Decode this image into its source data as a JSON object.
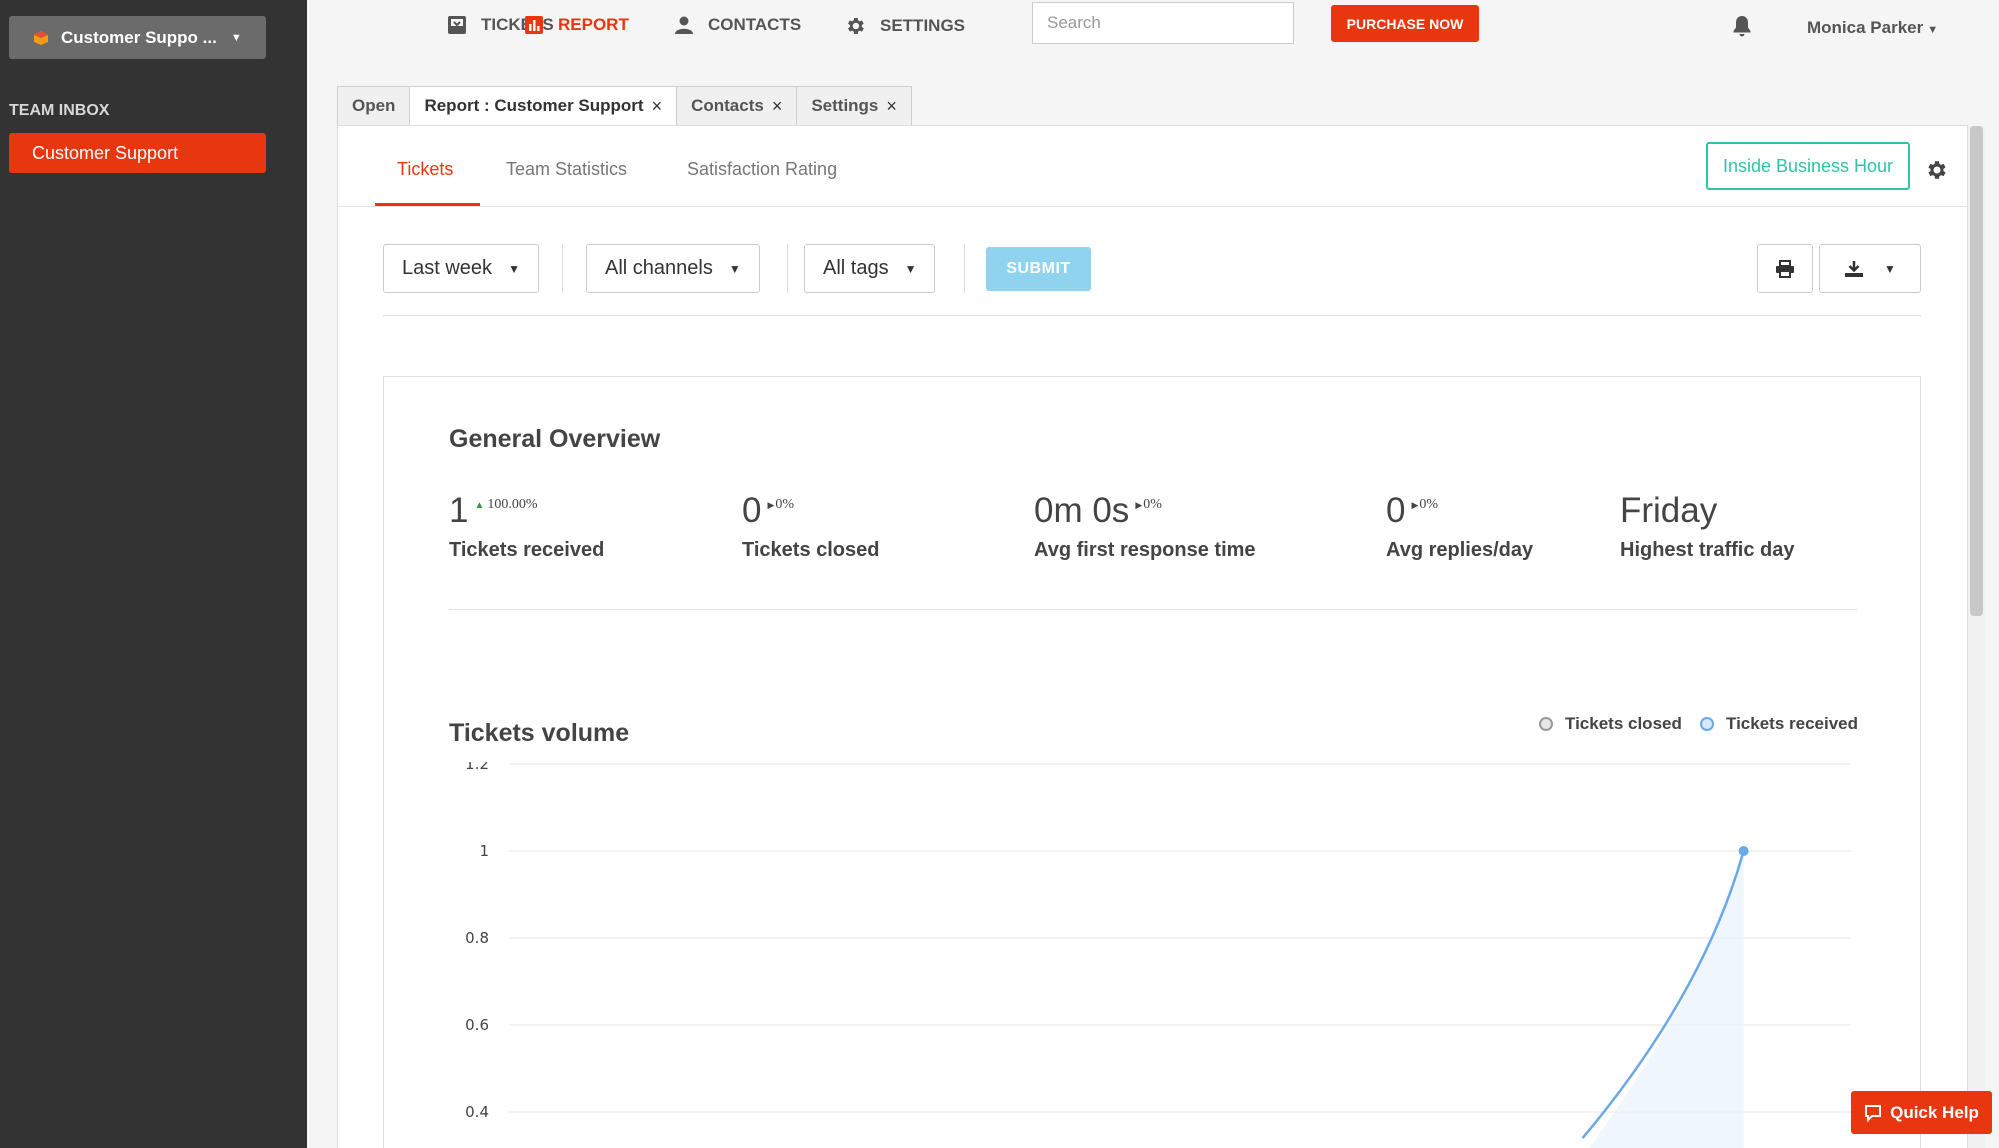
{
  "sidebar": {
    "inbox_selector": "Customer Suppo ...",
    "section_label": "TEAM INBOX",
    "items": [
      {
        "label": "Customer Support",
        "active": true
      }
    ]
  },
  "topnav": {
    "items": [
      {
        "label": "TICKETS",
        "icon": "ticket-icon"
      },
      {
        "label": "REPORT",
        "icon": "report-icon",
        "active": true
      },
      {
        "label": "CONTACTS",
        "icon": "contact-icon"
      },
      {
        "label": "SETTINGS",
        "icon": "gear-icon"
      }
    ],
    "search_placeholder": "Search",
    "purchase_label": "PURCHASE NOW",
    "user_name": "Monica Parker"
  },
  "tabs": [
    {
      "label": "Open",
      "closable": false
    },
    {
      "label": "Report : Customer Support",
      "closable": true,
      "active": true
    },
    {
      "label": "Contacts",
      "closable": true
    },
    {
      "label": "Settings",
      "closable": true
    }
  ],
  "close_glyph": "×",
  "subtabs": [
    "Tickets",
    "Team Statistics",
    "Satisfaction Rating"
  ],
  "business_hour_label": "Inside Business Hour",
  "filters": {
    "period": "Last week",
    "channels": "All channels",
    "tags": "All tags",
    "submit_label": "SUBMIT"
  },
  "overview": {
    "title": "General Overview",
    "stats": [
      {
        "value": "1",
        "delta": "100.00%",
        "trend": "up",
        "label": "Tickets received"
      },
      {
        "value": "0",
        "delta": "0%",
        "trend": "flat",
        "label": "Tickets closed"
      },
      {
        "value": "0m 0s",
        "delta": "0%",
        "trend": "flat",
        "label": "Avg first response time"
      },
      {
        "value": "0",
        "delta": "0%",
        "trend": "flat",
        "label": "Avg replies/day"
      },
      {
        "value": "Friday",
        "delta": "",
        "trend": "",
        "label": "Highest traffic day"
      }
    ]
  },
  "volume": {
    "title": "Tickets volume",
    "legend": [
      {
        "name": "Tickets closed",
        "color": "#999999"
      },
      {
        "name": "Tickets received",
        "color": "#6aa8e8"
      }
    ]
  },
  "chart_data": {
    "type": "line",
    "title": "Tickets volume",
    "y_ticks": [
      "1.2",
      "1",
      "0.8",
      "0.6",
      "0.4"
    ],
    "ylim": [
      0.4,
      1.2
    ],
    "grid": true,
    "legend_position": "top-right",
    "series": [
      {
        "name": "Tickets received",
        "color": "#6aa8e8",
        "points_visible": [
          {
            "x_frac": 0.8,
            "y": 0.34
          },
          {
            "x_frac": 0.92,
            "y": 1
          }
        ]
      },
      {
        "name": "Tickets closed",
        "color": "#999999",
        "points_visible": []
      }
    ]
  },
  "quick_help_label": "Quick Help",
  "colors": {
    "brand": "#e8360f",
    "accent": "#2ec4a6",
    "submit": "#8fd3ef",
    "series_received": "#6aa8e8"
  }
}
